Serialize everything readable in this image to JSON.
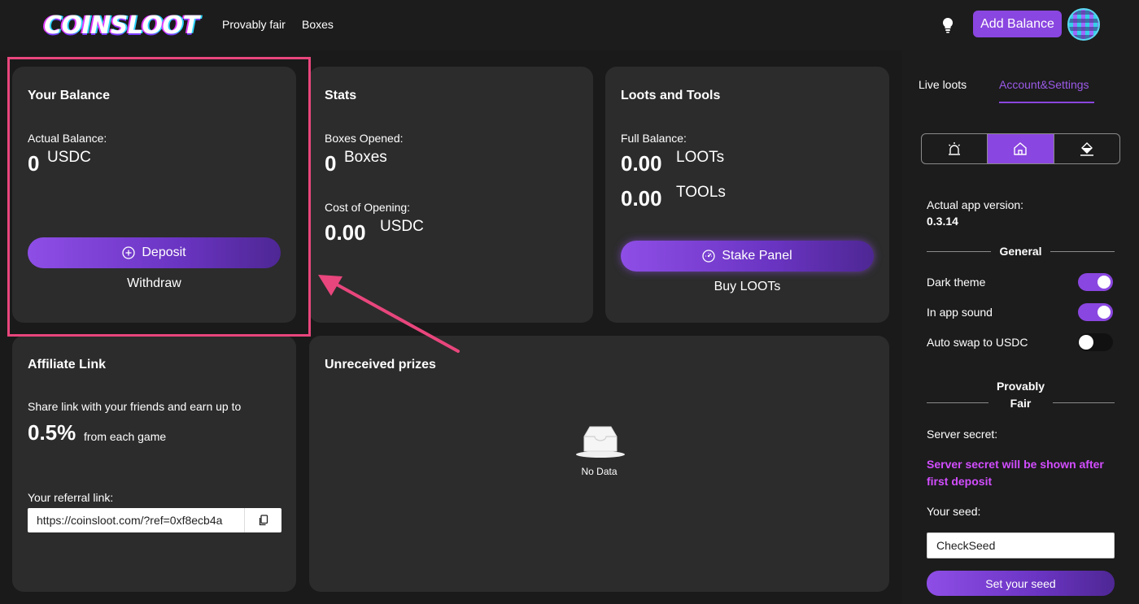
{
  "header": {
    "logo": "COINSLOOT",
    "nav": [
      "Provably fair",
      "Boxes"
    ],
    "add_balance_label": "Add Balance"
  },
  "balance": {
    "title": "Your Balance",
    "actual_label": "Actual Balance:",
    "amount": "0",
    "unit": "USDC",
    "deposit_label": "Deposit",
    "withdraw_label": "Withdraw"
  },
  "stats": {
    "title": "Stats",
    "boxes_label": "Boxes Opened:",
    "boxes_value": "0",
    "boxes_unit": "Boxes",
    "cost_label": "Cost of Opening:",
    "cost_value": "0.00",
    "cost_unit": "USDC"
  },
  "loots": {
    "title": "Loots and Tools",
    "full_label": "Full Balance:",
    "loot_value": "0.00",
    "loot_unit": "LOOTs",
    "tool_value": "0.00",
    "tool_unit": "TOOLs",
    "stake_label": "Stake Panel",
    "buy_label": "Buy LOOTs"
  },
  "affiliate": {
    "title": "Affiliate Link",
    "share_text": "Share link with your friends and earn up to",
    "percent": "0.5%",
    "percent_suffix": "from each game",
    "ref_label": "Your referral link:",
    "ref_value": "https://coinsloot.com/?ref=0xf8ecb4a"
  },
  "prizes": {
    "title": "Unreceived prizes",
    "empty_text": "No Data"
  },
  "sidebar": {
    "tabs": [
      "Live loots",
      "Account&Settings"
    ],
    "active_tab": 1,
    "segments": [
      "alarm-icon",
      "home-icon",
      "paint-bucket-icon"
    ],
    "active_segment": 1,
    "version_label": "Actual app version:",
    "version_value": "0.3.14",
    "general_heading": "General",
    "settings": [
      {
        "label": "Dark theme",
        "on": true
      },
      {
        "label": "In app sound",
        "on": true
      },
      {
        "label": "Auto swap to USDC",
        "on": false
      }
    ],
    "provably_heading_1": "Provably",
    "provably_heading_2": "Fair",
    "server_secret_label": "Server secret:",
    "server_secret_note": "Server secret will be shown after first deposit",
    "seed_label": "Your seed:",
    "seed_value": "CheckSeed",
    "set_seed_label": "Set your seed"
  },
  "colors": {
    "accent": "#8a46e0",
    "secret_note": "#d24dff",
    "highlight": "#e8467c",
    "card_bg": "#2c2c2c",
    "page_bg": "#1a1a1a"
  }
}
